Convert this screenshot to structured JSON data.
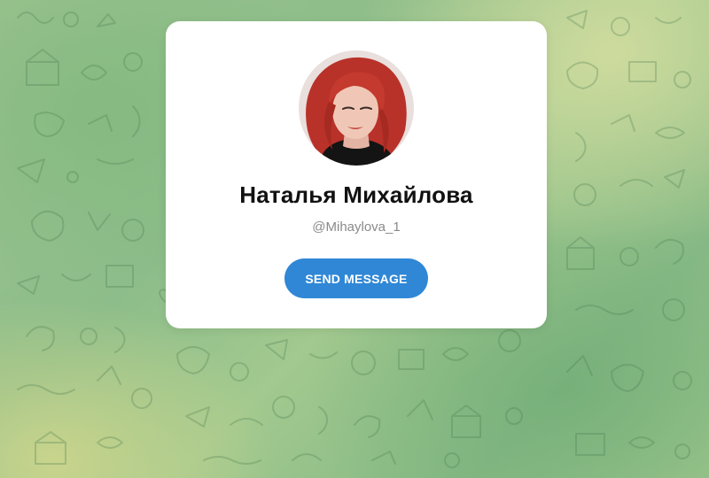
{
  "background": {
    "pattern": "telegram-doodle-pattern",
    "colors": [
      "#9cc38f",
      "#d6dea0",
      "#86b985"
    ]
  },
  "profile": {
    "name": "Наталья Михайлова",
    "username": "@Mihaylova_1",
    "avatar_icon": "profile-photo"
  },
  "actions": {
    "send_message_label": "SEND MESSAGE",
    "accent_color": "#2f87d6"
  }
}
